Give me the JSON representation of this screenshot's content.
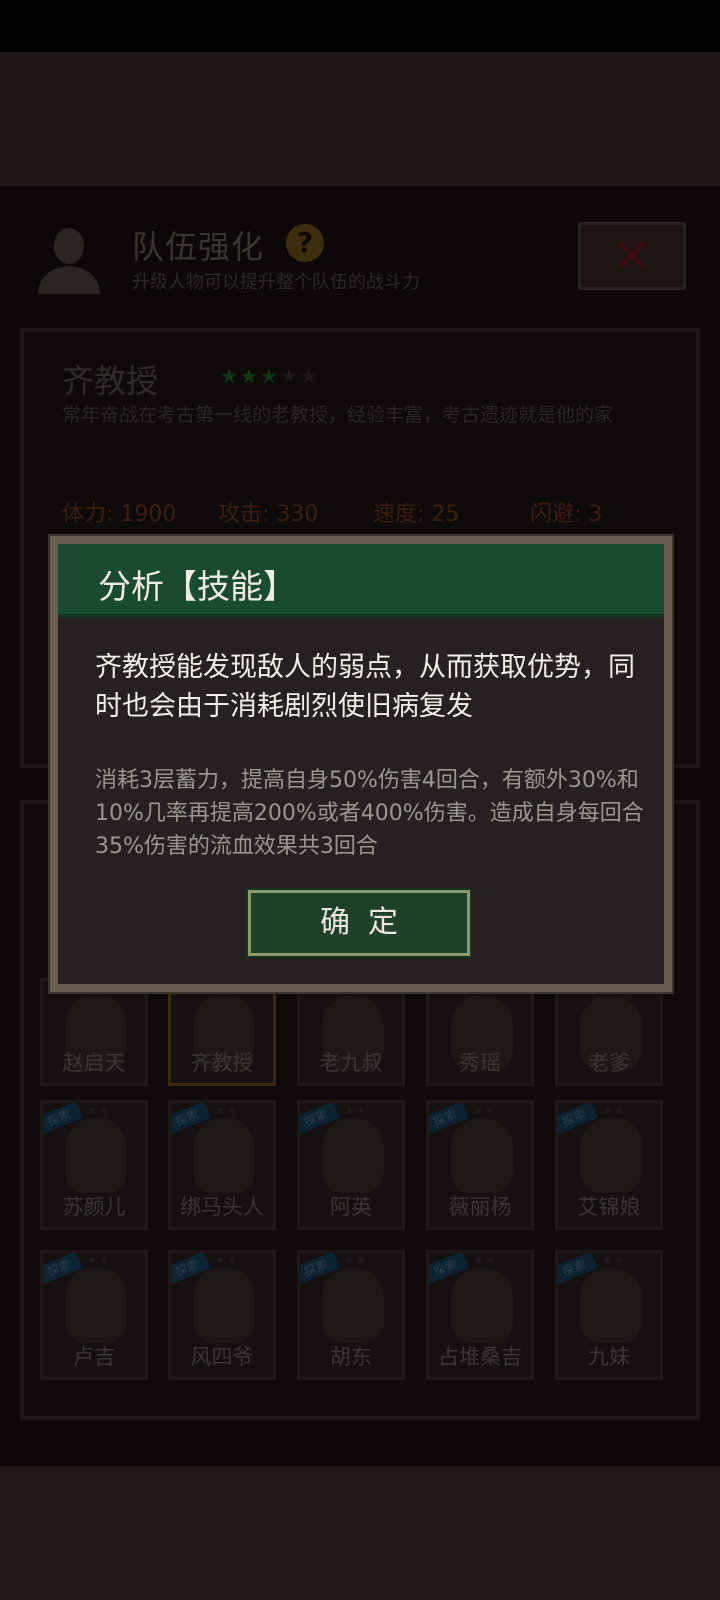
{
  "header": {
    "title": "队伍强化",
    "help_symbol": "?",
    "subtitle": "升级人物可以提升整个队伍的战斗力",
    "close_symbol": "✕"
  },
  "character": {
    "name": "齐教授",
    "stars_filled": 3,
    "stars_total": 5,
    "description": "常年奋战在考古第一线的老教授，经验丰富，考古遗迹就是他的家",
    "stats": {
      "hp": "体力: 1900",
      "attack": "攻击: 330",
      "speed": "速度: 25",
      "dodge": "闪避: 3"
    }
  },
  "roster": [
    {
      "name": "赵启天",
      "tag": ""
    },
    {
      "name": "齐教授",
      "tag": "",
      "selected": true
    },
    {
      "name": "老九叔",
      "tag": ""
    },
    {
      "name": "秀瑶",
      "tag": ""
    },
    {
      "name": "老爹",
      "tag": ""
    },
    {
      "name": "苏颜儿",
      "tag": "探索"
    },
    {
      "name": "绑马头人",
      "tag": "探索"
    },
    {
      "name": "阿英",
      "tag": "探索"
    },
    {
      "name": "薇丽杨",
      "tag": "探索"
    },
    {
      "name": "艾锦娘",
      "tag": "探索"
    },
    {
      "name": "卢吉",
      "tag": "探索"
    },
    {
      "name": "风四爷",
      "tag": "探索"
    },
    {
      "name": "胡东",
      "tag": "探索"
    },
    {
      "name": "占堆桑吉",
      "tag": "探索"
    },
    {
      "name": "九妹",
      "tag": "探索"
    }
  ],
  "dialog": {
    "title": "分析【技能】",
    "text": "齐教授能发现敌人的弱点，从而获取优势，同时也会由于消耗剧烈使旧病复发",
    "effect": "消耗3层蓄力，提高自身50%伤害4回合，有额外30%和10%几率再提高200%或者400%伤害。造成自身每回合35%伤害的流血效果共3回合",
    "confirm_label": "确定"
  },
  "colors": {
    "dialog_header": "#1b4a33",
    "confirm_button": "#1e4128",
    "dialog_frame": "#6b5d50"
  }
}
